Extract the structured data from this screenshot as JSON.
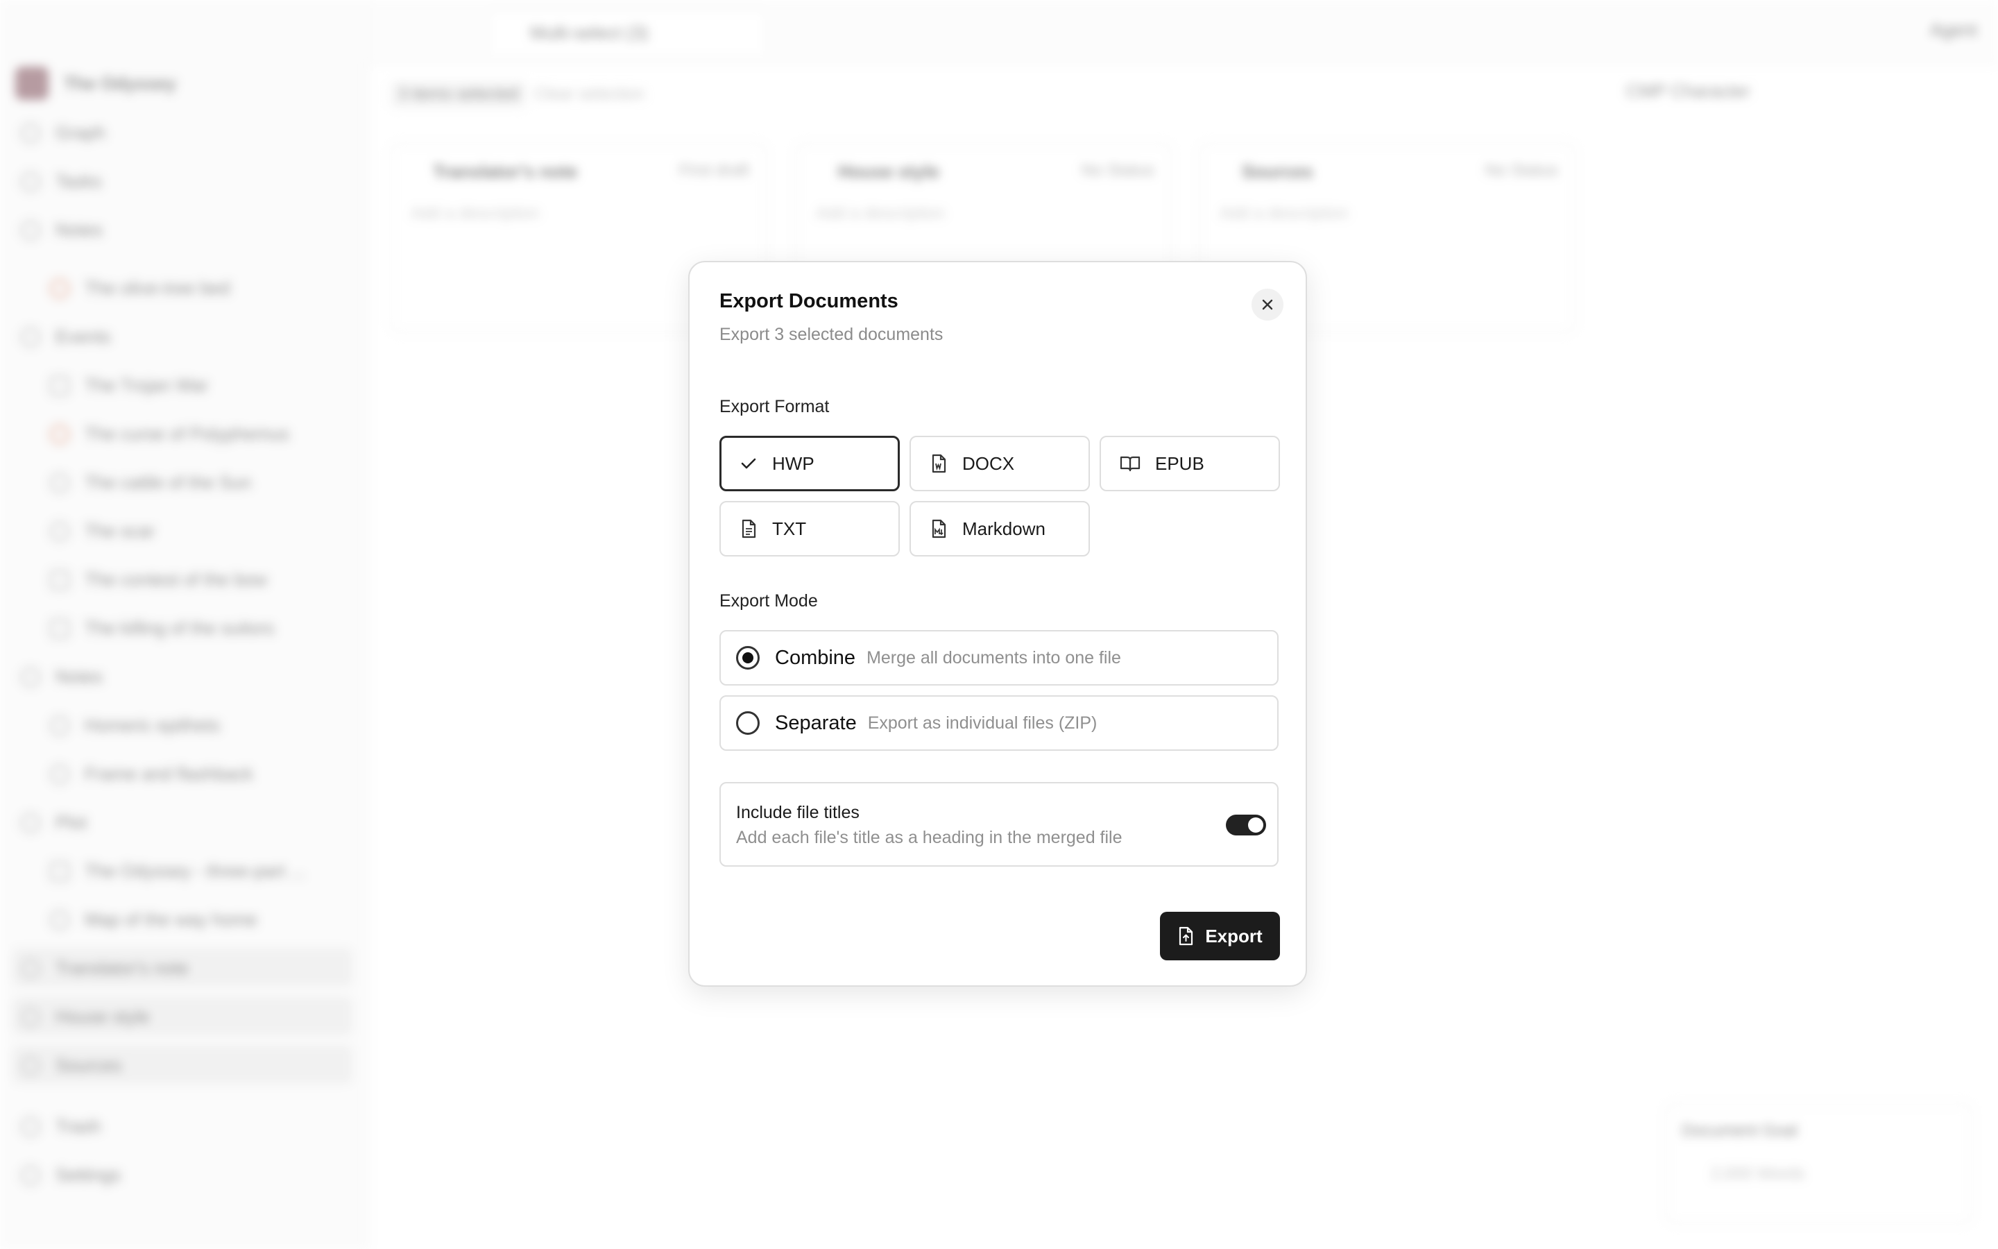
{
  "background": {
    "workspace_name": "The Odyssey",
    "sidebar_items": [
      {
        "label": "Graph"
      },
      {
        "label": "Tasks"
      },
      {
        "label": "Notes"
      },
      {
        "label": "The olive-tree bed"
      },
      {
        "label": "Events"
      },
      {
        "label": "The Trojan War"
      },
      {
        "label": "The curse of Polyphemus"
      },
      {
        "label": "The cattle of the Sun"
      },
      {
        "label": "The scar"
      },
      {
        "label": "The contest of the bow"
      },
      {
        "label": "The killing of the suitors"
      },
      {
        "label": "Notes"
      },
      {
        "label": "Homeric epithets"
      },
      {
        "label": "Frame and flashback"
      },
      {
        "label": "Plot"
      },
      {
        "label": "The Odyssey - three-part ..."
      },
      {
        "label": "Map of the way home"
      },
      {
        "label": "Translator's note"
      },
      {
        "label": "House style"
      },
      {
        "label": "Sources"
      },
      {
        "label": "Trash"
      },
      {
        "label": "Settings"
      }
    ],
    "tab_label": "Multi-select (3)",
    "agent_label": "Agent",
    "selection_label": "3 items selected",
    "clear_label": "Clear selection",
    "view_label": "CMP Character",
    "cards": [
      {
        "title": "Translator's note",
        "status": "First draft",
        "desc": "Add a description"
      },
      {
        "title": "House style",
        "status": "No Status",
        "desc": "Add a description"
      },
      {
        "title": "Sources",
        "status": "No Status",
        "desc": "Add a description"
      }
    ],
    "goal": {
      "title": "Document Goal",
      "value": "2,000 Words"
    }
  },
  "modal": {
    "title": "Export Documents",
    "subtitle": "Export 3 selected documents",
    "format_label": "Export Format",
    "formats": [
      {
        "label": "HWP",
        "icon": "check-icon",
        "selected": true
      },
      {
        "label": "DOCX",
        "icon": "file-word-icon",
        "selected": false
      },
      {
        "label": "EPUB",
        "icon": "book-open-icon",
        "selected": false
      },
      {
        "label": "TXT",
        "icon": "file-text-icon",
        "selected": false
      },
      {
        "label": "Markdown",
        "icon": "file-markdown-icon",
        "selected": false
      }
    ],
    "mode_label": "Export Mode",
    "modes": [
      {
        "label": "Combine",
        "desc": "Merge all documents into one file",
        "selected": true
      },
      {
        "label": "Separate",
        "desc": "Export as individual files (ZIP)",
        "selected": false
      }
    ],
    "include_titles": {
      "label": "Include file titles",
      "desc": "Add each file's title as a heading in the merged file",
      "enabled": true
    },
    "export_button": "Export"
  }
}
